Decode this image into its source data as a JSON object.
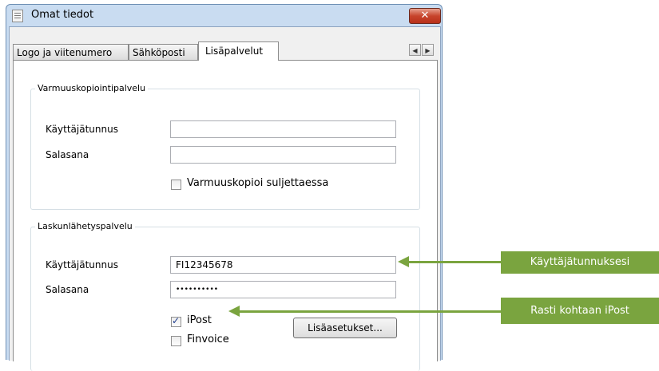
{
  "window": {
    "title": "Omat tiedot",
    "close_glyph": "✕"
  },
  "tabs": [
    {
      "label": "Logo ja viitenumero",
      "active": false
    },
    {
      "label": "Sähköposti",
      "active": false
    },
    {
      "label": "Lisäpalvelut",
      "active": true
    }
  ],
  "tab_scroll": {
    "left": "◀",
    "right": "▶"
  },
  "backup_group": {
    "title": "Varmuuskopiointipalvelu",
    "username_label": "Käyttäjätunnus",
    "username_value": "",
    "password_label": "Salasana",
    "password_value": "",
    "checkbox_label": "Varmuuskopioi suljettaessa",
    "checkbox_checked": false
  },
  "invoice_group": {
    "title": "Laskunlähetyspalvelu",
    "username_label": "Käyttäjätunnus",
    "username_value": "FI12345678",
    "password_label": "Salasana",
    "password_value": "••••••••••",
    "ipost_label": "iPost",
    "ipost_checked": true,
    "finvoice_label": "Finvoice",
    "finvoice_checked": false,
    "advanced_button": "Lisäasetukset..."
  },
  "callouts": {
    "username_hint": "Käyttäjätunnuksesi",
    "ipost_hint": "Rasti kohtaan iPost"
  },
  "colors": {
    "callout_green": "#7aa43f",
    "title_bar": "#c9dcf1",
    "close_red": "#c7442c"
  }
}
